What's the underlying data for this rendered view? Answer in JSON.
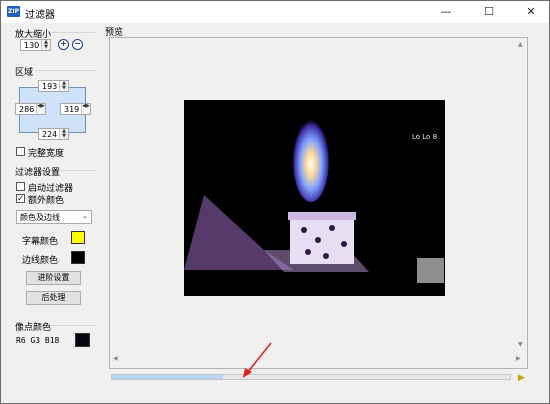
{
  "window": {
    "title": "过滤器",
    "app_icon_text": "ZIP"
  },
  "zoom": {
    "group_label": "放大缩小",
    "value": "130"
  },
  "region": {
    "group_label": "区域",
    "top": "193",
    "left": "286",
    "right": "319",
    "bottom": "224",
    "full_width_label": "完整宽度",
    "full_width_checked": false
  },
  "filter": {
    "group_label": "过滤器设置",
    "enable_label": "启动过滤器",
    "enable_checked": false,
    "extra_color_label": "额外颜色",
    "extra_color_checked": true,
    "mode_select": "颜色及边线",
    "font_color_label": "字幕颜色",
    "font_color": "#ffff00",
    "border_color_label": "边线颜色",
    "border_color": "#000000",
    "advanced_button": "进阶设置",
    "post_button": "后处理"
  },
  "pixel": {
    "group_label": "像点颜色",
    "value_text": "R6 G3 B18",
    "swatch_color": "#060312"
  },
  "preview": {
    "group_label": "预览",
    "watermark": "Lo Lo 8"
  },
  "playback": {
    "progress": 0.28
  }
}
